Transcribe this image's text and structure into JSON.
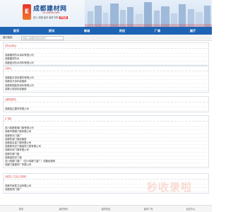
{
  "brand": {
    "mark": "E",
    "title": "成都建材网",
    "domain": "cd.ytbsw.com",
    "tagline": "四川 成都 建材 装修 材料",
    "tagline_badge": "手机版",
    "primary_color": "#1e64b4",
    "accent_color": "#e8352e"
  },
  "nav": {
    "items": [
      {
        "label": "首页"
      },
      {
        "label": "资讯"
      },
      {
        "label": "商城"
      },
      {
        "label": "供应"
      },
      {
        "label": "厂商"
      },
      {
        "label": "展厅"
      }
    ]
  },
  "search": {
    "label": "建材搜索",
    "placeholder": "请输入您要搜索的关键词"
  },
  "sections": [
    {
      "title": "[防水涂料]",
      "rows": [
        "",
        "成都建材防水涂料有限公司",
        "成都建材防水",
        "成都蓝天防水材料有限公司"
      ]
    },
    {
      "title": "[涂料]",
      "rows": [
        "",
        "成都星宇涂料建材有限公司",
        "成都百万涂料经营部",
        "成都家园装饰涂料有限公司",
        "成都川西涂料经营部"
      ]
    },
    {
      "title": "[建筑建材]",
      "rows": [
        "",
        "成都金正建材有限公司"
      ]
    },
    {
      "title": "[门窗]",
      "rows": [
        "",
        "四川成都玻璃门窗有限公司",
        "成都市塑钢门窗有限公司",
        "成都阳光门窗厂",
        "成都防盗门窗经营部",
        "成都铝合金门窗有限公司",
        "成都新世纪门窗装饰工程有限公司",
        "成都永安门窗有限公司",
        "成都华美门窗",
        "成都金阳光门窗",
        "四川成都门窗厂（四川成都门窗厂）成都经销商",
        "成都门窗建材厂有限公司"
      ]
    },
    {
      "title": "[家具] [卫浴] [厨房]",
      "rows": [
        "",
        "成都市家居卫浴有限公司",
        "成都厨具门窗厂"
      ]
    }
  ],
  "footer": {
    "tabs": [
      {
        "label": "首页"
      },
      {
        "label": "建材资讯"
      },
      {
        "label": "建材供应"
      },
      {
        "label": "建材厂商"
      },
      {
        "label": "会员中心"
      }
    ]
  },
  "watermark": {
    "text": "秒收录啦"
  }
}
